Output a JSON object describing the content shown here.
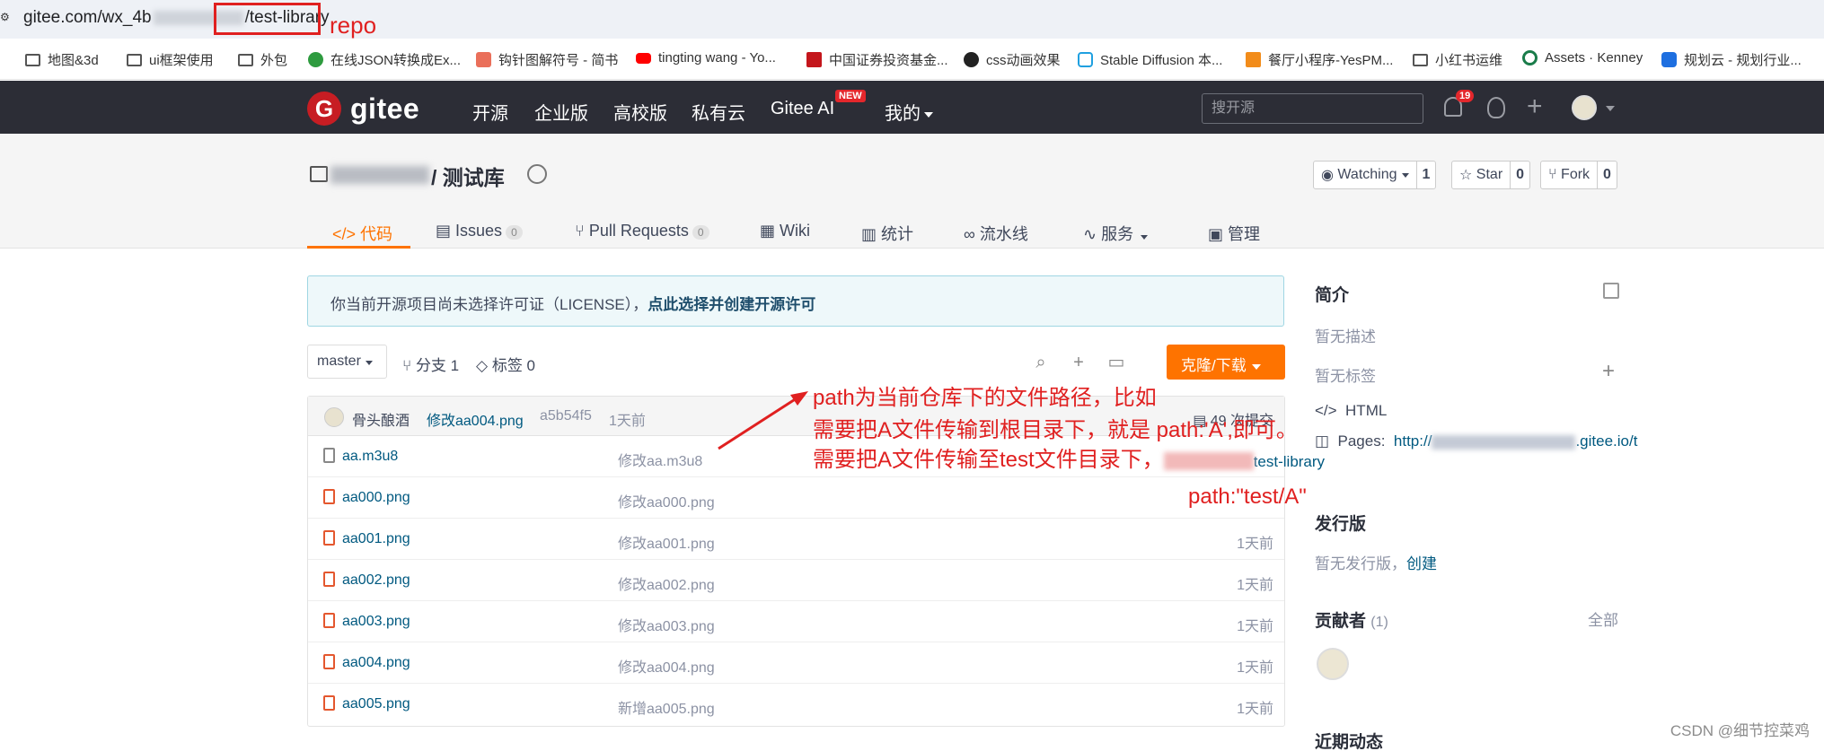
{
  "browser": {
    "url_prefix": "gitee.com/wx_4b",
    "url_suffix": "/test-library",
    "annotation": "repo",
    "bookmarks": [
      {
        "label": "地图&3d",
        "icon": "folder-icon"
      },
      {
        "label": "ui框架使用",
        "icon": "folder-icon"
      },
      {
        "label": "外包",
        "icon": "folder-icon"
      },
      {
        "label": "在线JSON转换成Ex...",
        "icon": "json-icon"
      },
      {
        "label": "钩针图解符号 - 简书",
        "icon": "jianshu-icon"
      },
      {
        "label": "tingting wang - Yo...",
        "icon": "youtube-icon"
      },
      {
        "label": "中国证券投资基金...",
        "icon": "fund-icon"
      },
      {
        "label": "css动画效果",
        "icon": "a-icon"
      },
      {
        "label": "Stable Diffusion 本...",
        "icon": "bilibili-icon"
      },
      {
        "label": "餐厅小程序-YesPM...",
        "icon": "check-icon"
      },
      {
        "label": "小红书运维",
        "icon": "folder-icon"
      },
      {
        "label": "Assets · Kenney",
        "icon": "ring-icon"
      },
      {
        "label": "规划云 - 规划行业...",
        "icon": "cloud-icon"
      }
    ]
  },
  "header": {
    "logo_text": "gitee",
    "logo_letter": "G",
    "nav": [
      "开源",
      "企业版",
      "高校版",
      "私有云",
      "Gitee AI",
      "我的"
    ],
    "new_badge": "NEW",
    "search_placeholder": "搜开源",
    "notification_count": "19"
  },
  "repo": {
    "name": "/ 测试库",
    "watching_label": "Watching",
    "watching_count": "1",
    "star_label": "Star",
    "star_count": "0",
    "fork_label": "Fork",
    "fork_count": "0",
    "tabs": [
      {
        "label": "代码",
        "icon": "</>",
        "count": null
      },
      {
        "label": "Issues",
        "icon": "▤",
        "count": "0"
      },
      {
        "label": "Pull Requests",
        "icon": "⑂",
        "count": "0"
      },
      {
        "label": "Wiki",
        "icon": "▦",
        "count": null
      },
      {
        "label": "统计",
        "icon": "▥",
        "count": null
      },
      {
        "label": "流水线",
        "icon": "∞",
        "count": null
      },
      {
        "label": "服务",
        "icon": "∿",
        "count": null
      },
      {
        "label": "管理",
        "icon": "▣",
        "count": null
      }
    ]
  },
  "license": {
    "text": "你当前开源项目尚未选择许可证（LICENSE），",
    "link": "点此选择并创建开源许可"
  },
  "toolbar": {
    "branch": "master",
    "branches": "分支 1",
    "tags": "标签 0",
    "clone": "克隆/下载"
  },
  "commit": {
    "author": "骨头酿酒",
    "message": "修改aa004.png",
    "sha": "a5b54f5",
    "time": "1天前",
    "count": "49 次提交"
  },
  "files": [
    {
      "name": "aa.m3u8",
      "message": "修改aa.m3u8",
      "time": "",
      "type": "text"
    },
    {
      "name": "aa000.png",
      "message": "修改aa000.png",
      "time": "",
      "type": "image"
    },
    {
      "name": "aa001.png",
      "message": "修改aa001.png",
      "time": "1天前",
      "type": "image"
    },
    {
      "name": "aa002.png",
      "message": "修改aa002.png",
      "time": "1天前",
      "type": "image"
    },
    {
      "name": "aa003.png",
      "message": "修改aa003.png",
      "time": "1天前",
      "type": "image"
    },
    {
      "name": "aa004.png",
      "message": "修改aa004.png",
      "time": "1天前",
      "type": "image"
    },
    {
      "name": "aa005.png",
      "message": "新增aa005.png",
      "time": "1天前",
      "type": "image"
    }
  ],
  "annotation": {
    "line1": "path为当前仓库下的文件路径，比如",
    "line2": "需要把A文件传输到根目录下，就是 path:'A',即可。",
    "line3_a": "需要把A文件传输至test文件目录下，",
    "line3_b": "test-library",
    "line4": "path:\"test/A\""
  },
  "sidebar": {
    "intro_title": "简介",
    "no_desc": "暂无描述",
    "no_tags": "暂无标签",
    "lang": "HTML",
    "pages_label": "Pages:",
    "pages_url_start": "http://",
    "pages_url_end": ".gitee.io/t",
    "release_title": "发行版",
    "no_release": "暂无发行版，",
    "create": "创建",
    "contributors_title": "贡献者",
    "contributors_count": "(1)",
    "all": "全部",
    "recent_title": "近期动态"
  },
  "watermark": "CSDN @细节控菜鸡",
  "colors": {
    "accent": "#fe7300",
    "header_bg": "#2c2d36",
    "annotation": "#e02020",
    "link": "#005980"
  }
}
